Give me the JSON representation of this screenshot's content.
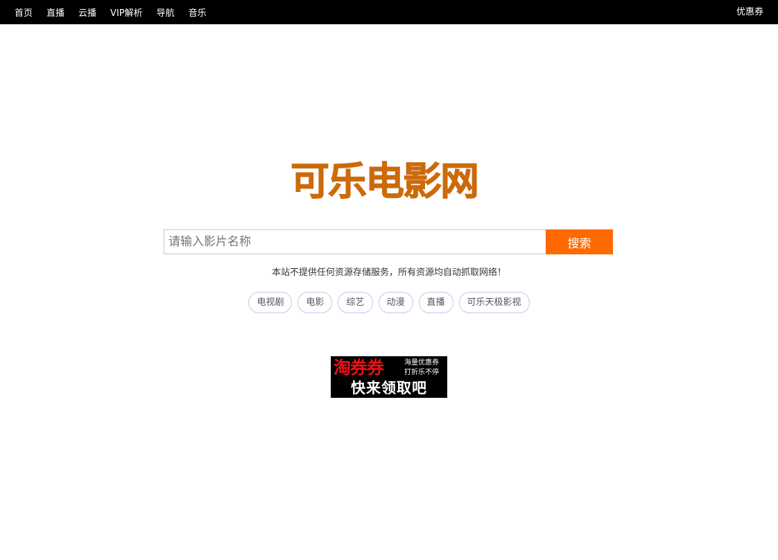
{
  "nav": {
    "items": [
      {
        "label": "首页"
      },
      {
        "label": "直播"
      },
      {
        "label": "云播"
      },
      {
        "label": "VIP解析"
      },
      {
        "label": "导航"
      },
      {
        "label": "音乐"
      }
    ],
    "coupon_label": "优惠券"
  },
  "logo": {
    "text": "可乐电影网",
    "color": "#cc6a0a"
  },
  "search": {
    "placeholder": "请输入影片名称",
    "value": "",
    "button_label": "搜索",
    "button_color": "#ff6a00"
  },
  "notice": "本站不提供任何资源存储服务，所有资源均自动抓取网络！",
  "tags": [
    {
      "label": "电视剧"
    },
    {
      "label": "电影"
    },
    {
      "label": "综艺"
    },
    {
      "label": "动漫"
    },
    {
      "label": "直播"
    },
    {
      "label": "可乐天极影视"
    }
  ],
  "banner": {
    "title": "淘券券",
    "line1": "海量优惠券",
    "line2": "打折乐不停",
    "bottom": "快来领取吧"
  }
}
